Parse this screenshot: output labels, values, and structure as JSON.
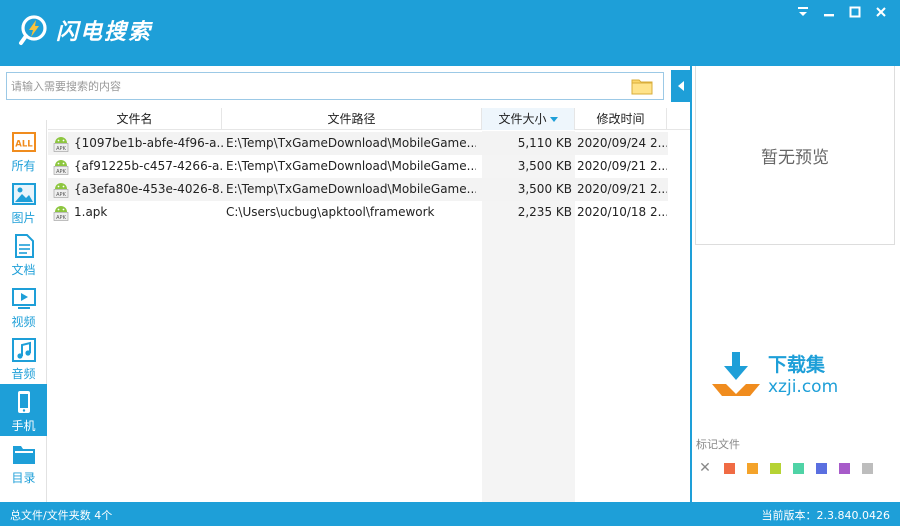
{
  "app": {
    "title": "闪电搜索"
  },
  "search": {
    "placeholder": "请输入需要搜索的内容",
    "value": ""
  },
  "sidebar": {
    "items": [
      {
        "label": "所有",
        "icon": "all-icon"
      },
      {
        "label": "图片",
        "icon": "image-icon"
      },
      {
        "label": "文档",
        "icon": "document-icon"
      },
      {
        "label": "视频",
        "icon": "video-icon"
      },
      {
        "label": "音频",
        "icon": "audio-icon"
      },
      {
        "label": "手机",
        "icon": "phone-icon",
        "active": true
      },
      {
        "label": "目录",
        "icon": "folder-icon"
      }
    ],
    "all_badge": "ALL"
  },
  "table": {
    "columns": [
      "文件名",
      "文件路径",
      "文件大小",
      "修改时间"
    ],
    "sort_column": "文件大小",
    "rows": [
      {
        "name": "{1097be1b-abfe-4f96-a...",
        "path": "E:\\Temp\\TxGameDownload\\MobileGame...",
        "size": "5,110 KB",
        "date": "2020/09/24 2..."
      },
      {
        "name": "{af91225b-c457-4266-a...",
        "path": "E:\\Temp\\TxGameDownload\\MobileGame...",
        "size": "3,500 KB",
        "date": "2020/09/21 2..."
      },
      {
        "name": "{a3efa80e-453e-4026-8...",
        "path": "E:\\Temp\\TxGameDownload\\MobileGame...",
        "size": "3,500 KB",
        "date": "2020/09/21 2..."
      },
      {
        "name": "1.apk",
        "path": "C:\\Users\\ucbug\\apktool\\framework",
        "size": "2,235 KB",
        "date": "2020/10/18 2..."
      }
    ],
    "file_icon_text": "APK"
  },
  "preview": {
    "empty_text": "暂无预览"
  },
  "watermark": {
    "title": "下载集",
    "domain": "xzji.com"
  },
  "marks": {
    "label": "标记文件",
    "clear": "✕",
    "colors": [
      "#f06b44",
      "#f4a32a",
      "#b6d334",
      "#4fd3a6",
      "#5a6fe0",
      "#a75bc9",
      "#bdbdbd"
    ]
  },
  "status": {
    "left": "总文件/文件夹数 4个",
    "right": "当前版本：2.3.840.0426"
  },
  "theme": {
    "accent": "#1e9fd8"
  }
}
